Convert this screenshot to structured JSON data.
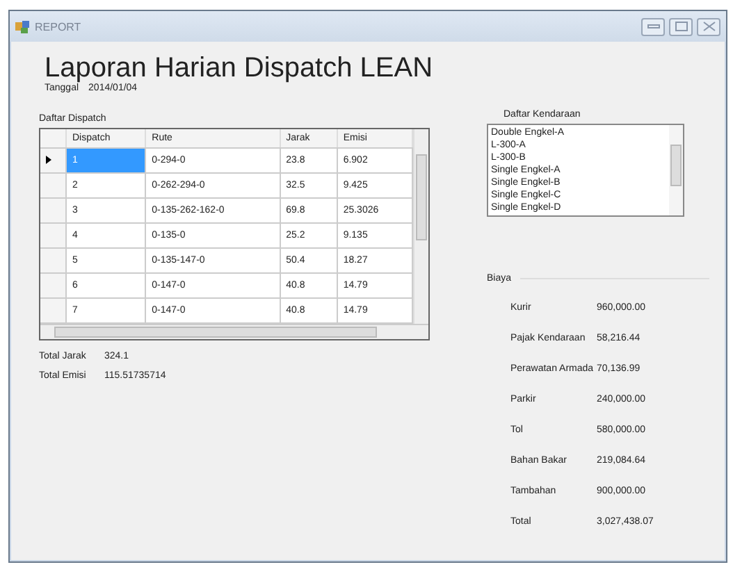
{
  "window": {
    "title": "REPORT"
  },
  "header": {
    "title": "Laporan Harian Dispatch LEAN",
    "date_label": "Tanggal",
    "date": "2014/01/04"
  },
  "dispatch": {
    "label": "Daftar Dispatch",
    "columns": [
      "Dispatch",
      "Rute",
      "Jarak",
      "Emisi"
    ],
    "rows": [
      {
        "cells": [
          "1",
          "0-294-0",
          "23.8",
          "6.902"
        ],
        "selected": true
      },
      {
        "cells": [
          "2",
          "0-262-294-0",
          "32.5",
          "9.425"
        ],
        "selected": false
      },
      {
        "cells": [
          "3",
          "0-135-262-162-0",
          "69.8",
          "25.3026"
        ],
        "selected": false
      },
      {
        "cells": [
          "4",
          "0-135-0",
          "25.2",
          "9.135"
        ],
        "selected": false
      },
      {
        "cells": [
          "5",
          "0-135-147-0",
          "50.4",
          "18.27"
        ],
        "selected": false
      },
      {
        "cells": [
          "6",
          "0-147-0",
          "40.8",
          "14.79"
        ],
        "selected": false
      },
      {
        "cells": [
          "7",
          "0-147-0",
          "40.8",
          "14.79"
        ],
        "selected": false
      }
    ]
  },
  "totals": [
    {
      "label": "Total Jarak",
      "value": "324.1"
    },
    {
      "label": "Total Emisi",
      "value": "115.51735714"
    }
  ],
  "vehicles": {
    "label": "Daftar Kendaraan",
    "items": [
      "Double Engkel-A",
      "L-300-A",
      "L-300-B",
      "Single Engkel-A",
      "Single Engkel-B",
      "Single Engkel-C",
      "Single Engkel-D"
    ]
  },
  "costs": {
    "label": "Biaya",
    "items": [
      {
        "label": "Kurir",
        "value": "960,000.00"
      },
      {
        "label": "Pajak Kendaraan",
        "value": "58,216.44"
      },
      {
        "label": "Perawatan Armada",
        "value": "70,136.99"
      },
      {
        "label": "Parkir",
        "value": "240,000.00"
      },
      {
        "label": "Tol",
        "value": "580,000.00"
      },
      {
        "label": "Bahan Bakar",
        "value": "219,084.64"
      },
      {
        "label": "Tambahan",
        "value": "900,000.00"
      },
      {
        "label": "Total",
        "value": "3,027,438.07"
      }
    ]
  }
}
